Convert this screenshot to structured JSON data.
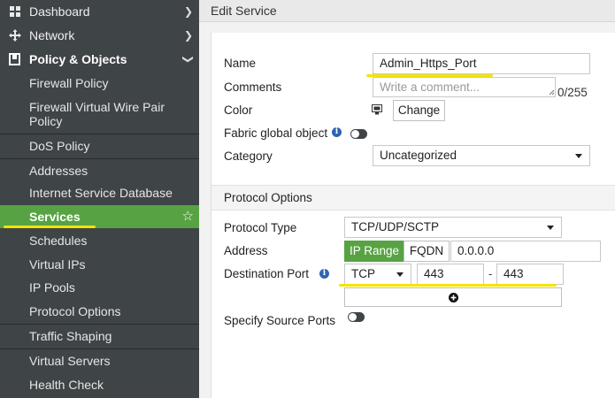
{
  "sidebar": {
    "top_items": [
      {
        "label": "Dashboard",
        "icon": "dashboard-icon"
      },
      {
        "label": "Network",
        "icon": "network-icon"
      },
      {
        "label": "Policy & Objects",
        "icon": "policy-objects-icon"
      }
    ],
    "sub_items": [
      {
        "label": "Firewall Policy"
      },
      {
        "label": "Firewall Virtual Wire Pair"
      },
      {
        "label": "Policy"
      },
      {
        "label": "DoS Policy"
      },
      {
        "label": "Addresses"
      },
      {
        "label": "Internet Service Database"
      },
      {
        "label": "Services"
      },
      {
        "label": "Schedules"
      },
      {
        "label": "Virtual IPs"
      },
      {
        "label": "IP Pools"
      },
      {
        "label": "Protocol Options"
      },
      {
        "label": "Traffic Shaping"
      },
      {
        "label": "Virtual Servers"
      },
      {
        "label": "Health Check"
      }
    ],
    "active_item": "Services",
    "accent_color": "#57a343"
  },
  "header": {
    "title": "Edit Service"
  },
  "form": {
    "name_label": "Name",
    "name_value": "Admin_Https_Port",
    "comments_label": "Comments",
    "comments_placeholder": "Write a comment...",
    "comments_counter": "0/255",
    "color_label": "Color",
    "color_button": "Change",
    "fabric_label": "Fabric global object",
    "category_label": "Category",
    "category_value": "Uncategorized"
  },
  "protocol": {
    "section_title": "Protocol Options",
    "type_label": "Protocol Type",
    "type_value": "TCP/UDP/SCTP",
    "address_label": "Address",
    "address_btn_iprange": "IP Range",
    "address_btn_fqdn": "FQDN",
    "address_value": "0.0.0.0",
    "dest_port_label": "Destination Port",
    "dest_proto_value": "TCP",
    "dest_port_low": "443",
    "dest_port_sep": "-",
    "dest_port_high": "443",
    "source_ports_label": "Specify Source Ports"
  },
  "colors": {
    "highlight": "#f4e400",
    "toggle": "#3f4447",
    "info": "#2e64b2"
  }
}
